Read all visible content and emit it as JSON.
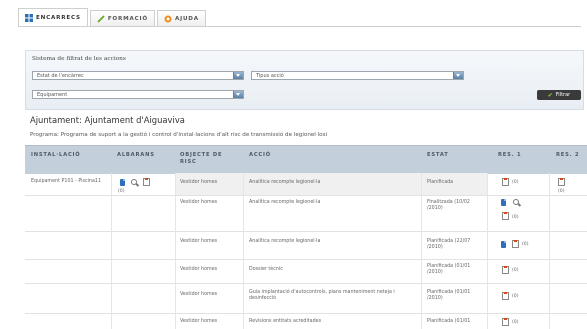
{
  "tabs": [
    {
      "label": "ENCARRECS",
      "icon": "grid-icon",
      "active": true
    },
    {
      "label": "FORMACIÓ",
      "icon": "pencil-icon",
      "active": false
    },
    {
      "label": "AJUDA",
      "icon": "help-icon",
      "active": false
    }
  ],
  "filter": {
    "title": "Sistema de filtrat de les accions",
    "select_state": "Estat de l'encàrrec",
    "select_type": "Tipus acció",
    "select_equipment": "Equipament",
    "button_label": "Filtrar"
  },
  "org": {
    "title": "Ajuntament: Ajuntament d'Aiguaviva",
    "program": "Programa: Programa de suport a la gestió i control d'instal·lacions d'alt risc de transmissió de legionel·losi"
  },
  "table": {
    "headers": {
      "installation": "INSTAL·LACIÓ",
      "albarans": "ALBARANS",
      "objecte": "OBJECTE DE RISC",
      "accio": "ACCIÓ",
      "estat": "ESTAT",
      "res1": "RES. 1",
      "res2": "RES. 2"
    },
    "installation": "Equipament P101 - Piscina11",
    "albarans_count": "(0)",
    "res2_count": "(0)",
    "rows": [
      {
        "objecte": "Vestidor homes",
        "accio": "Analítica recompte legionel·la",
        "estat": "Planificada",
        "res1_count": "(0)"
      },
      {
        "objecte": "Vestidor homes",
        "accio": "Analítica recompte legionel·la",
        "estat": "Finalitzada (10/02 /2010)",
        "res1_count": "(0)"
      },
      {
        "objecte": "Vestidor homes",
        "accio": "Analítica recompte legionel·la",
        "estat": "Planificada (22/07 /2010)",
        "res1_count": "(0)"
      },
      {
        "objecte": "Vestidor homes",
        "accio": "Dossier tècnic",
        "estat": "Planificada (01/01 /2010)",
        "res1_count": "(0)"
      },
      {
        "objecte": "Vestidor homes",
        "accio": "Guia implantació d'autocontrols, plans manteniment neteja i desinfecció",
        "estat": "Planificada (01/01 /2010)",
        "res1_count": "(0)"
      },
      {
        "objecte": "Vestidor homes",
        "accio": "Revisions entitats acreditades",
        "estat": "Planificada (01/01",
        "res1_count": "(0)"
      }
    ]
  },
  "colors": {
    "header_bg": "#c3cfda",
    "button_bg": "#3a3a3a",
    "accent": "#2d6fb8"
  }
}
